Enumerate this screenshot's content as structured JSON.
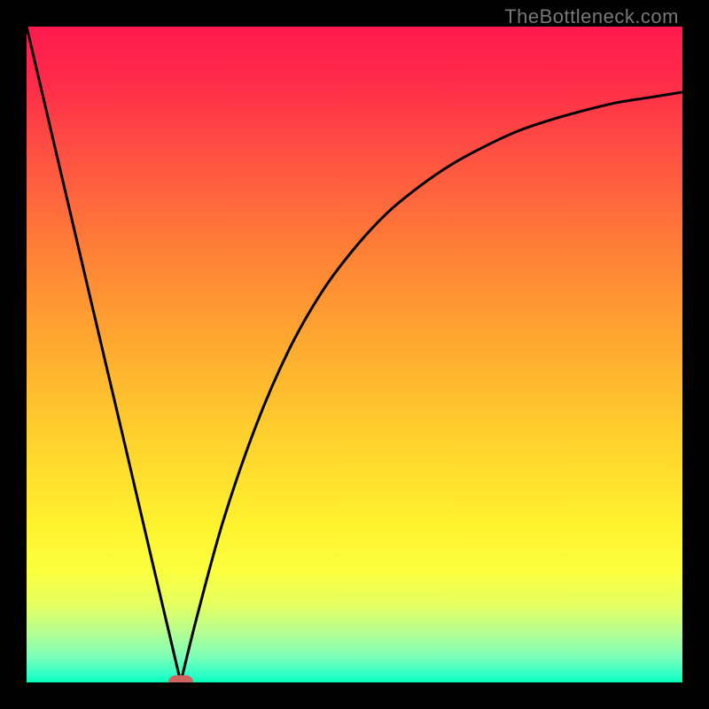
{
  "watermark": "TheBottleneck.com",
  "colors": {
    "frame": "#000000",
    "curve": "#000000",
    "marker": "#d06262",
    "gradient_top": "#ff1a4d",
    "gradient_bottom": "#00ffb3"
  },
  "chart_data": {
    "type": "line",
    "title": "",
    "xlabel": "",
    "ylabel": "",
    "xlim": [
      0,
      100
    ],
    "ylim": [
      0,
      100
    ],
    "grid": false,
    "series": [
      {
        "name": "left-descent",
        "x": [
          0,
          5,
          10,
          15,
          19,
          22,
          23.5
        ],
        "values": [
          100,
          78.7,
          57.4,
          36.2,
          19.1,
          6.4,
          0
        ]
      },
      {
        "name": "right-ascent-curve",
        "x": [
          23.5,
          26,
          30,
          35,
          40,
          45,
          50,
          55,
          60,
          65,
          70,
          75,
          80,
          85,
          90,
          95,
          100
        ],
        "values": [
          0,
          10.1,
          24.7,
          39.2,
          50.7,
          59.5,
          66.2,
          71.6,
          75.7,
          79.1,
          81.8,
          84.1,
          85.8,
          87.2,
          88.4,
          89.2,
          90.0
        ]
      }
    ],
    "marker": {
      "x": 23.5,
      "y": 0
    },
    "annotations": []
  }
}
